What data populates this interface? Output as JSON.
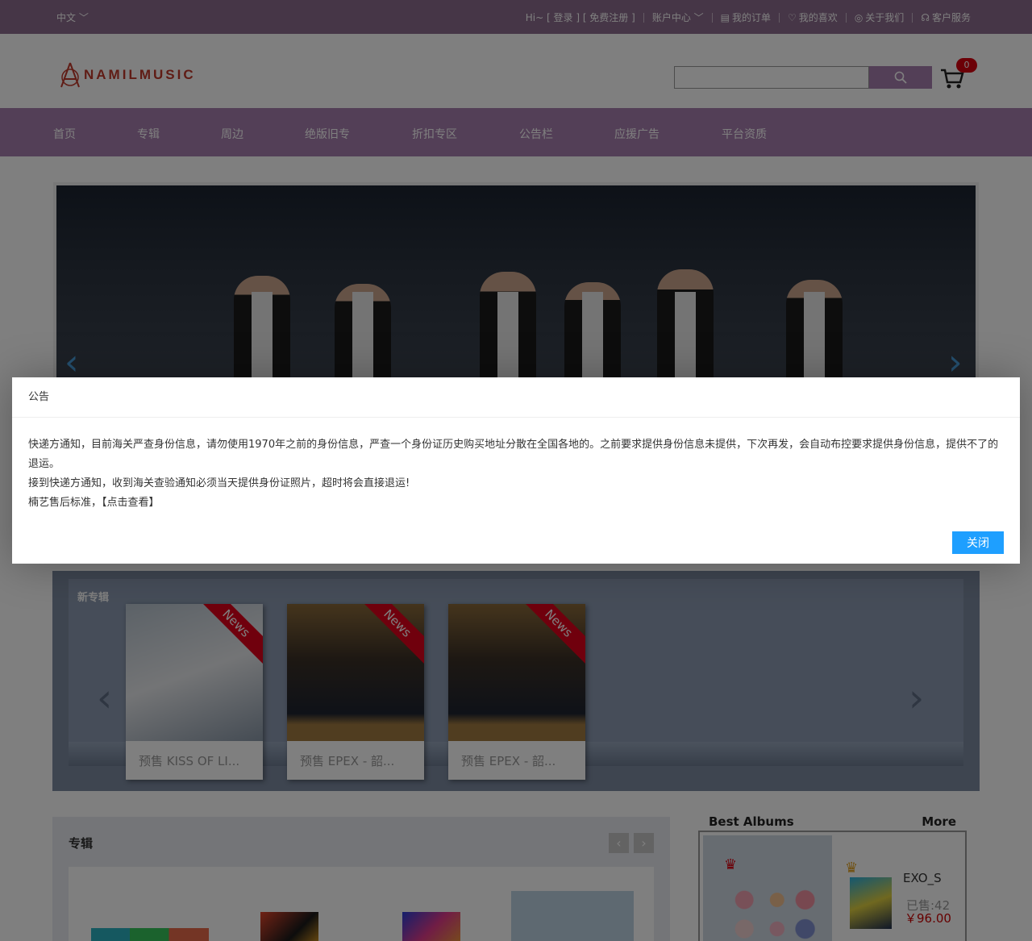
{
  "topbar": {
    "lang": "中文",
    "greeting": "Hi~ [ 登录 ] [ 免费注册 ]",
    "account": "账户中心",
    "orders": "我的订单",
    "favorites": "我的喜欢",
    "about": "关于我们",
    "service": "客户服务"
  },
  "header": {
    "logo": "NAMILMUSIC",
    "cart_count": "0"
  },
  "nav": [
    {
      "label": "首页"
    },
    {
      "label": "专辑"
    },
    {
      "label": "周边"
    },
    {
      "label": "绝版旧专"
    },
    {
      "label": "折扣专区"
    },
    {
      "label": "公告栏"
    },
    {
      "label": "应援广告"
    },
    {
      "label": "平台资质"
    }
  ],
  "new_albums": {
    "title": "新专辑",
    "items": [
      {
        "tag": "News",
        "name": "预售 KISS OF LI..."
      },
      {
        "tag": "News",
        "name": "预售 EPEX - 韶..."
      },
      {
        "tag": "News",
        "name": "预售 EPEX - 韶..."
      }
    ]
  },
  "albums": {
    "title": "专辑",
    "prev": "‹",
    "next": "›"
  },
  "best": {
    "title": "Best Albums",
    "more": "More",
    "product": "EXO_S",
    "sold": "已售:42",
    "price": "￥96.00"
  },
  "modal": {
    "title": "公告",
    "line1": "快递方通知，目前海关严查身份信息，请勿使用1970年之前的身份信息，严查一个身份证历史购买地址分散在全国各地的。之前要求提供身份信息未提供，下次再发，会自动布控要求提供身份信息，提供不了的退运。",
    "line2": "接到快递方通知，收到海关查验通知必须当天提供身份证照片，超时将会直接退运!",
    "line3a": "楠艺售后标准，",
    "line3b": "【点击查看】",
    "close": "关闭"
  },
  "colors": {
    "brand": "#a77fae",
    "accent": "#1e9fff",
    "badge": "#d9000e"
  }
}
